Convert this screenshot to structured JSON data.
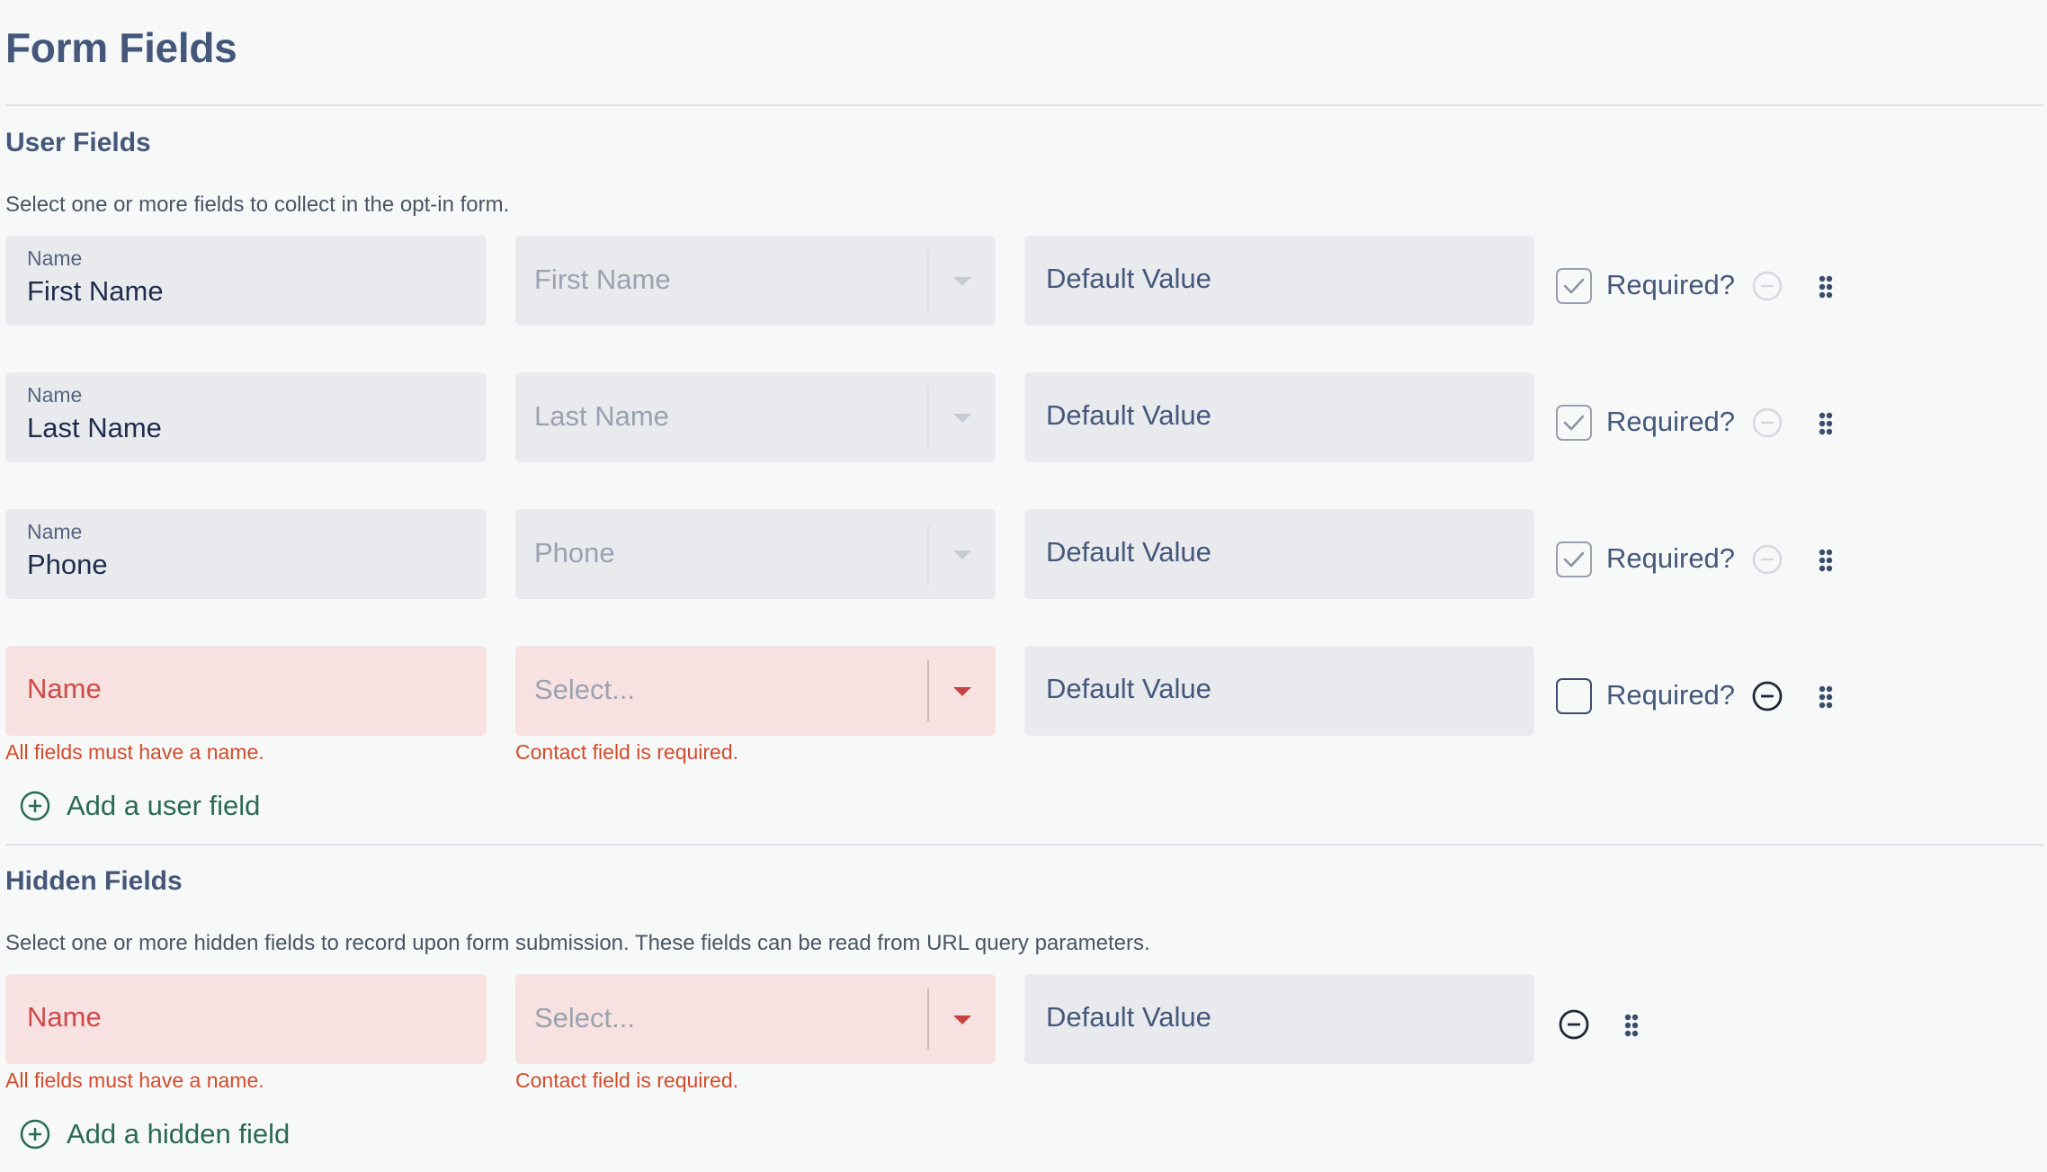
{
  "page": {
    "title": "Form Fields"
  },
  "user_fields": {
    "title": "User Fields",
    "description": "Select one or more fields to collect in the opt-in form.",
    "rows": [
      {
        "name_label": "Name",
        "name_value": "First Name",
        "contact_field": "First Name",
        "default_placeholder": "Default Value",
        "required_label": "Required?",
        "required": true
      },
      {
        "name_label": "Name",
        "name_value": "Last Name",
        "contact_field": "Last Name",
        "default_placeholder": "Default Value",
        "required_label": "Required?",
        "required": true
      },
      {
        "name_label": "Name",
        "name_value": "Phone",
        "contact_field": "Phone",
        "default_placeholder": "Default Value",
        "required_label": "Required?",
        "required": true
      },
      {
        "name_placeholder": "Name",
        "contact_placeholder": "Select...",
        "default_placeholder": "Default Value",
        "required_label": "Required?",
        "required": false,
        "name_error": "All fields must have a name.",
        "contact_error": "Contact field is required."
      }
    ],
    "add_label": "Add a user field"
  },
  "hidden_fields": {
    "title": "Hidden Fields",
    "description": "Select one or more hidden fields to record upon form submission. These fields can be read from URL query parameters.",
    "rows": [
      {
        "name_placeholder": "Name",
        "contact_placeholder": "Select...",
        "default_placeholder": "Default Value",
        "name_error": "All fields must have a name.",
        "contact_error": "Contact field is required."
      }
    ],
    "add_label": "Add a hidden field"
  },
  "colors": {
    "title": "#45577a",
    "error_text": "#d34b2a",
    "error_bg": "#f8e1e1",
    "field_bg": "#e8eaee",
    "add_link": "#2b6a52"
  },
  "icons": [
    "check-icon",
    "minus-circle-icon",
    "drag-handle-icon",
    "plus-circle-icon",
    "chevron-down-icon"
  ]
}
